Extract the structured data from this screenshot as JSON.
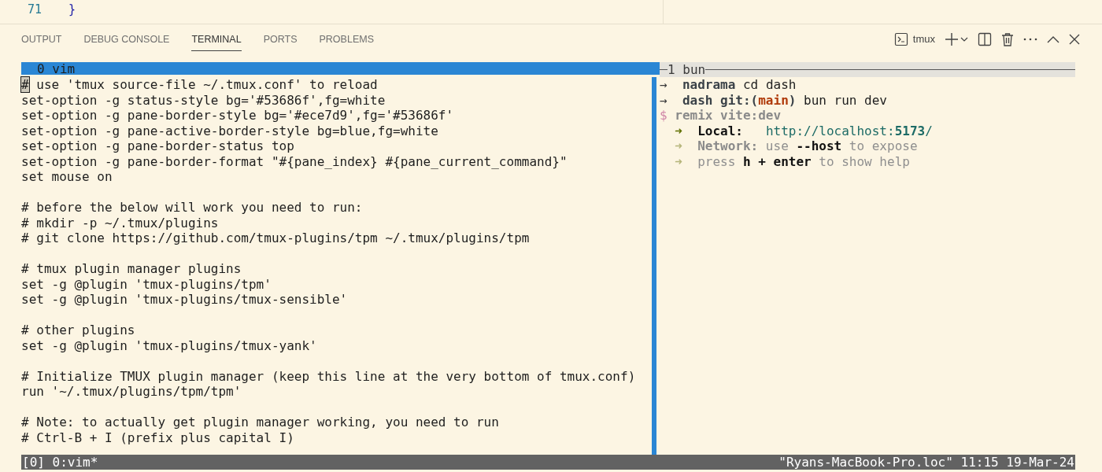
{
  "editor": {
    "line_number": "71",
    "code": "}"
  },
  "panel_tabs": [
    {
      "label": "OUTPUT",
      "selected": false
    },
    {
      "label": "DEBUG CONSOLE",
      "selected": false
    },
    {
      "label": "TERMINAL",
      "selected": true
    },
    {
      "label": "PORTS",
      "selected": false
    },
    {
      "label": "PROBLEMS",
      "selected": false
    }
  ],
  "terminal_toolbar": {
    "terminal_name": "tmux"
  },
  "tmux": {
    "panes": [
      {
        "title": "0 vim",
        "active": true,
        "lines": [
          {
            "kind": "text",
            "segments": [
              {
                "text": "#",
                "kind": "cursor"
              },
              {
                "text": " use 'tmux source-file ~/.tmux.conf' to reload",
                "kind": "plain"
              }
            ]
          },
          {
            "kind": "text",
            "segments": [
              {
                "text": "set-option -g status-style bg='#53686f',fg=white",
                "kind": "plain"
              }
            ]
          },
          {
            "kind": "text",
            "segments": [
              {
                "text": "set-option -g pane-border-style bg='#ece7d9',fg='#53686f'",
                "kind": "plain"
              }
            ]
          },
          {
            "kind": "text",
            "segments": [
              {
                "text": "set-option -g pane-active-border-style bg=blue,fg=white",
                "kind": "plain"
              }
            ]
          },
          {
            "kind": "text",
            "segments": [
              {
                "text": "set-option -g pane-border-status top",
                "kind": "plain"
              }
            ]
          },
          {
            "kind": "text",
            "segments": [
              {
                "text": "set-option -g pane-border-format \"#{pane_index} #{pane_current_command}\"",
                "kind": "plain"
              }
            ]
          },
          {
            "kind": "text",
            "segments": [
              {
                "text": "set mouse on",
                "kind": "plain"
              }
            ]
          },
          {
            "kind": "blank"
          },
          {
            "kind": "text",
            "segments": [
              {
                "text": "# before the below will work you need to run:",
                "kind": "plain"
              }
            ]
          },
          {
            "kind": "text",
            "segments": [
              {
                "text": "# mkdir -p ~/.tmux/plugins",
                "kind": "plain"
              }
            ]
          },
          {
            "kind": "text",
            "segments": [
              {
                "text": "# git clone https://github.com/tmux-plugins/tpm ~/.tmux/plugins/tpm",
                "kind": "plain"
              }
            ]
          },
          {
            "kind": "blank"
          },
          {
            "kind": "text",
            "segments": [
              {
                "text": "# tmux plugin manager plugins",
                "kind": "plain"
              }
            ]
          },
          {
            "kind": "text",
            "segments": [
              {
                "text": "set -g @plugin 'tmux-plugins/tpm'",
                "kind": "plain"
              }
            ]
          },
          {
            "kind": "text",
            "segments": [
              {
                "text": "set -g @plugin 'tmux-plugins/tmux-sensible'",
                "kind": "plain"
              }
            ]
          },
          {
            "kind": "blank"
          },
          {
            "kind": "text",
            "segments": [
              {
                "text": "# other plugins",
                "kind": "plain"
              }
            ]
          },
          {
            "kind": "text",
            "segments": [
              {
                "text": "set -g @plugin 'tmux-plugins/tmux-yank'",
                "kind": "plain"
              }
            ]
          },
          {
            "kind": "blank"
          },
          {
            "kind": "text",
            "segments": [
              {
                "text": "# Initialize TMUX plugin manager (keep this line at the very bottom of tmux.conf)",
                "kind": "plain"
              }
            ]
          },
          {
            "kind": "text",
            "segments": [
              {
                "text": "run '~/.tmux/plugins/tpm/tpm'",
                "kind": "plain"
              }
            ]
          },
          {
            "kind": "blank"
          },
          {
            "kind": "text",
            "segments": [
              {
                "text": "# Note: to actually get plugin manager working, you need to run",
                "kind": "plain"
              }
            ]
          },
          {
            "kind": "text",
            "segments": [
              {
                "text": "# Ctrl-B + I (prefix plus capital I)",
                "kind": "plain"
              }
            ]
          }
        ]
      },
      {
        "title": "1 bun",
        "active": false,
        "lines": [
          {
            "kind": "text",
            "segments": [
              {
                "text": "→  ",
                "kind": "arrow"
              },
              {
                "text": "nadrama",
                "kind": "dir"
              },
              {
                "text": " cd dash",
                "kind": "plain"
              }
            ]
          },
          {
            "kind": "text",
            "segments": [
              {
                "text": "→  ",
                "kind": "arrow"
              },
              {
                "text": "dash git:(",
                "kind": "dir"
              },
              {
                "text": "main",
                "kind": "branch"
              },
              {
                "text": ")",
                "kind": "dir"
              },
              {
                "text": " bun run dev",
                "kind": "plain"
              }
            ]
          },
          {
            "kind": "text",
            "segments": [
              {
                "text": "$ ",
                "kind": "prompt"
              },
              {
                "text": "remix vite:dev",
                "kind": "dimbold"
              }
            ]
          },
          {
            "kind": "text",
            "segments": [
              {
                "text": "  ➜  ",
                "kind": "greenarrow"
              },
              {
                "text": "Local:   ",
                "kind": "bold"
              },
              {
                "text": "http://localhost:",
                "kind": "link"
              },
              {
                "text": "5173",
                "kind": "linkbold"
              },
              {
                "text": "/",
                "kind": "link"
              }
            ]
          },
          {
            "kind": "text",
            "segments": [
              {
                "text": "  ➜  ",
                "kind": "mutedarrow"
              },
              {
                "text": "Network:",
                "kind": "dimbold"
              },
              {
                "text": " use ",
                "kind": "dim"
              },
              {
                "text": "--host",
                "kind": "bold"
              },
              {
                "text": " to expose",
                "kind": "dim"
              }
            ]
          },
          {
            "kind": "text",
            "segments": [
              {
                "text": "  ➜  ",
                "kind": "mutedarrow"
              },
              {
                "text": "press ",
                "kind": "dim"
              },
              {
                "text": "h + enter",
                "kind": "bold"
              },
              {
                "text": " to show help",
                "kind": "dim"
              }
            ]
          }
        ]
      }
    ],
    "status_bar": {
      "left": "[0] 0:vim*",
      "right": "\"Ryans-MacBook-Pro.loc\" 11:15 19-Mar-24"
    }
  }
}
